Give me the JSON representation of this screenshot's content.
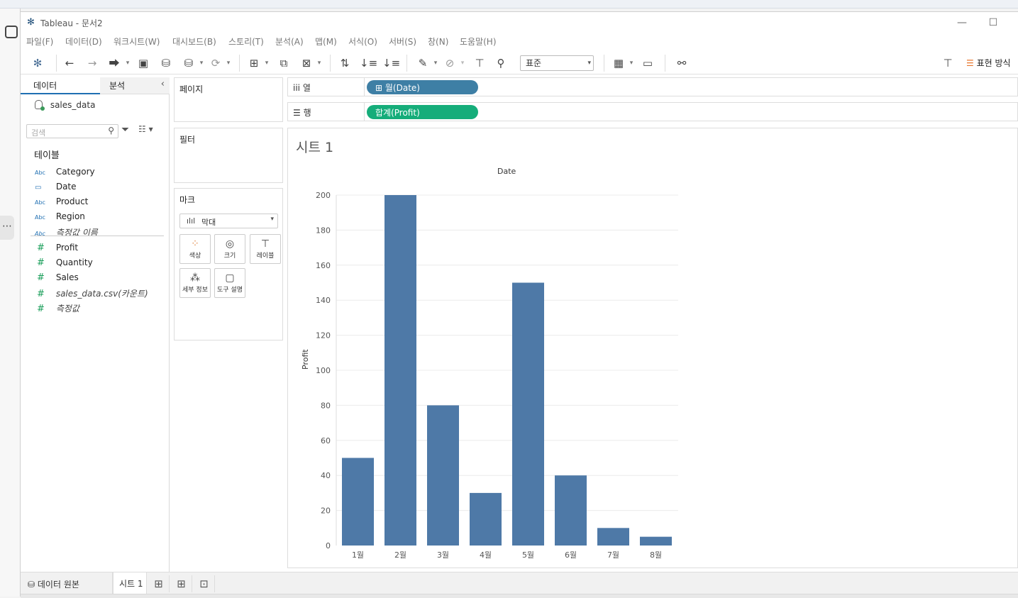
{
  "window": {
    "title": "Tableau - 문서2"
  },
  "menu": [
    "파일(F)",
    "데이터(D)",
    "워크시트(W)",
    "대시보드(B)",
    "스토리(T)",
    "분석(A)",
    "맵(M)",
    "서식(O)",
    "서버(S)",
    "창(N)",
    "도움말(H)"
  ],
  "toolbar": {
    "fit_value": "표준",
    "show_me_label": "표현 방식"
  },
  "data_pane": {
    "tab_data": "데이터",
    "tab_analysis": "분석",
    "source": "sales_data",
    "search_placeholder": "검색",
    "tables_header": "테이블",
    "dimensions": [
      {
        "type": "Abc",
        "name": "Category"
      },
      {
        "type": "date",
        "name": "Date"
      },
      {
        "type": "Abc",
        "name": "Product"
      },
      {
        "type": "Abc",
        "name": "Region"
      },
      {
        "type": "Abc",
        "name": "측정값 이름"
      }
    ],
    "measures": [
      {
        "type": "#",
        "name": "Profit"
      },
      {
        "type": "#",
        "name": "Quantity"
      },
      {
        "type": "#",
        "name": "Sales"
      },
      {
        "type": "#",
        "name": "sales_data.csv(카운트)"
      },
      {
        "type": "#",
        "name": "측정값"
      }
    ]
  },
  "cards": {
    "pages": "페이지",
    "filters": "필터",
    "marks": "마크",
    "mark_type": "막대",
    "mark_buttons": {
      "color": "색상",
      "size": "크기",
      "label": "레이블",
      "detail": "세부 정보",
      "tooltip": "도구 설명"
    }
  },
  "shelves": {
    "columns_label": "열",
    "rows_label": "행",
    "columns_pill": "월(Date)",
    "rows_pill": "합계(Profit)"
  },
  "sheet": {
    "title": "시트 1"
  },
  "chart_data": {
    "type": "bar",
    "title": "",
    "xlabel": "Date",
    "ylabel": "Profit",
    "categories": [
      "1월",
      "2월",
      "3월",
      "4월",
      "5월",
      "6월",
      "7월",
      "8월"
    ],
    "values": [
      50,
      200,
      80,
      30,
      150,
      40,
      10,
      5
    ],
    "ylim": [
      0,
      200
    ],
    "yticks": [
      0,
      20,
      40,
      60,
      80,
      100,
      120,
      140,
      160,
      180,
      200
    ],
    "color": "#4e79a7",
    "grid": true
  },
  "bottom": {
    "datasource_tab": "데이터 원본",
    "sheet_tab": "시트 1"
  }
}
